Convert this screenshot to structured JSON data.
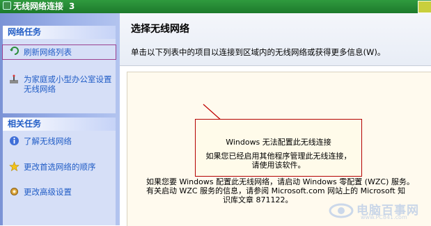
{
  "window": {
    "title": "无线网络连接",
    "title_suffix": "3"
  },
  "sidebar": {
    "network_tasks": {
      "header": "网络任务",
      "items": [
        {
          "label": "刷新网络列表",
          "icon": "refresh-icon"
        },
        {
          "label": "为家庭或小型办公室设置无线网络",
          "icon": "wireless-setup-icon"
        }
      ]
    },
    "related_tasks": {
      "header": "相关任务",
      "items": [
        {
          "label": "了解无线网络",
          "icon": "info-icon"
        },
        {
          "label": "更改首选网络的顺序",
          "icon": "star-icon"
        },
        {
          "label": "更改高级设置",
          "icon": "settings-icon"
        }
      ]
    }
  },
  "main": {
    "title": "选择无线网络",
    "description": "单击以下列表中的项目以连接到区域内的无线网络或获得更多信息(W)。",
    "message": {
      "line1": "Windows 无法配置此无线连接",
      "line2": "如果您已经启用其他程序管理此无线连接，",
      "line3": "请使用该软件。"
    },
    "wzc_info": {
      "line1": "如果您要 Windows 配置此无线网络，请启动 Windows 零配置 (WZC) 服务。",
      "line2": "有关启动 WZC 服务的信息，请参阅 Microsoft.com 网站上的 Microsoft 知",
      "line3": "识库文章 871122。"
    }
  },
  "watermark": {
    "text": "电脑百事网",
    "sub": "www.PC841.com"
  },
  "colors": {
    "titlebar": "#1d7a2c",
    "link": "#215dc6",
    "accent_red": "#b40000"
  }
}
